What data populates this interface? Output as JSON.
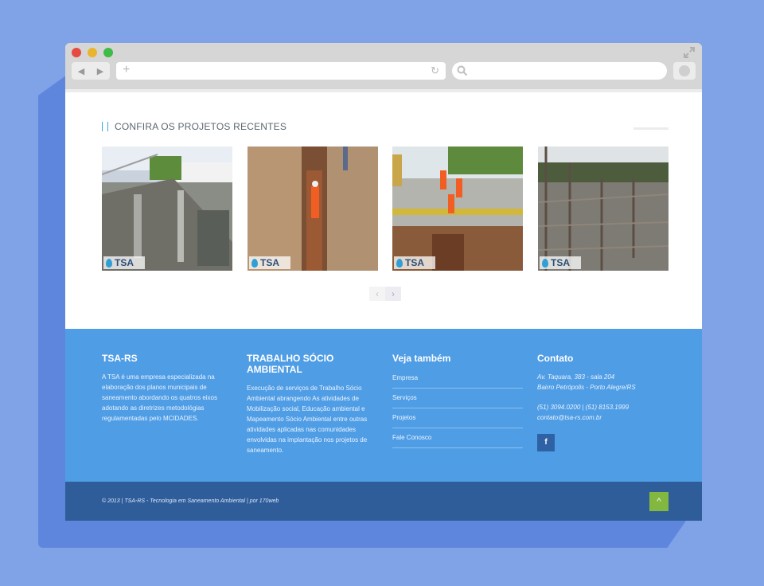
{
  "colors": {
    "background": "#7fa3e6",
    "footer": "#4f9de5",
    "bottombar": "#2f5d99",
    "accent": "#3aa6df",
    "totop": "#82b83f"
  },
  "projects": {
    "title": "CONFIRA OS PROJETOS RECENTES",
    "logo_text": "TSA",
    "pager_prev": "‹",
    "pager_next": "›"
  },
  "footer": {
    "about": {
      "title": "TSA-RS",
      "text": "A TSA é uma empresa especializada na elaboração dos planos municipais de saneamento abordando os quatros eixos adotando as diretrizes metodológias regulamentadas pelo MCIDADES."
    },
    "trabalho": {
      "title": "TRABALHO SÓCIO AMBIENTAL",
      "text": "Execução de serviços de Trabalho Sócio Ambiental abrangendo As atividades de Mobilização social, Educação ambiental e Mapeamento Sócio Ambiental entre outras atividades aplicadas nas comunidades envolvidas na implantação nos projetos de saneamento."
    },
    "veja": {
      "title": "Veja também",
      "links": [
        "Empresa",
        "Serviços",
        "Projetos",
        "Fale Conosco"
      ]
    },
    "contato": {
      "title": "Contato",
      "address1": "Av. Taquara, 383 - sala 204",
      "address2": "Bairro Petrópolis - Porto Alegre/RS",
      "phones": "(51) 3094.0200 | (51) 8153.1999",
      "email": "contato@tsa-rs.com.br",
      "facebook": "f"
    }
  },
  "bottom": {
    "copyright": "© 2013 | TSA-RS - Tecnologia em Saneamento Ambiental | por 170web",
    "totop": "^"
  }
}
